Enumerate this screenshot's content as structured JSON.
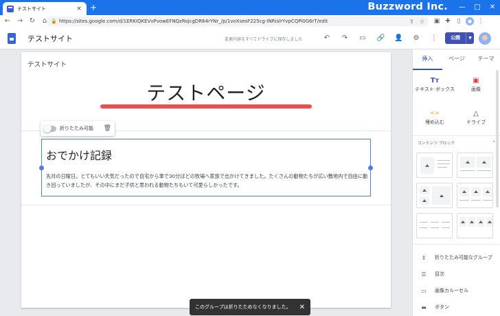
{
  "browser": {
    "tab_title": "テストサイト",
    "tab_close": "×",
    "new_tab": "+",
    "brand": "Buzzword Inc.",
    "url": "https://sites.google.com/d/1ERKIQKEVvPvowEFNQzRojcgDR64rYNr_/p/1voXsesF225cg-INRislrYvpCQPi0G6rT/edit",
    "nav_icons": [
      "back-icon",
      "forward-icon",
      "reload-icon",
      "home-icon"
    ],
    "window_controls": [
      "—",
      "□",
      "✕"
    ]
  },
  "app": {
    "site_title": "テストサイト",
    "autosave_status": "変更内容をすべてドライブに保存しました",
    "publish_label": "公開",
    "toolbar_icons": [
      "undo-icon",
      "redo-icon",
      "preview-icon",
      "link-icon",
      "share-icon",
      "settings-icon",
      "more-icon"
    ]
  },
  "page": {
    "site_name": "テストサイト",
    "heading": "テストページ",
    "highlight_color": "#f04e4e",
    "collapse_toggle_label": "折りたたみ可能",
    "textbox_title": "おでかけ記録",
    "textbox_body": "先月の日曜日。とてもいい天気だったので自宅から車で30分ほどの牧場へ家族で出かけてきました。たくさんの動物たちが広い敷地内で自由に動き回っていましたが、その中にまだ子供と思われる動物たちもいて可愛らしかったです。"
  },
  "toast": {
    "message": "このグループは折りたためなくなりました。",
    "close": "✕"
  },
  "panel": {
    "tabs": [
      "挿入",
      "ページ",
      "テーマ"
    ],
    "active_tab": "挿入",
    "insert_items": [
      {
        "label": "テキスト ボックス",
        "icon": "Tт"
      },
      {
        "label": "画像",
        "icon": "▣"
      },
      {
        "label": "埋め込む",
        "icon": "<>"
      },
      {
        "label": "ドライブ",
        "icon": "△"
      }
    ],
    "content_blocks_label": "コンテンツ ブロック",
    "list_items": [
      {
        "label": "折りたたみ可能なグループ",
        "icon": "⇕"
      },
      {
        "label": "目次",
        "icon": "☰"
      },
      {
        "label": "画像カルーセル",
        "icon": "▭"
      },
      {
        "label": "ボタン",
        "icon": "▬"
      }
    ]
  },
  "colors": {
    "accent": "#3f51b5",
    "chrome": "#1a73e8"
  }
}
